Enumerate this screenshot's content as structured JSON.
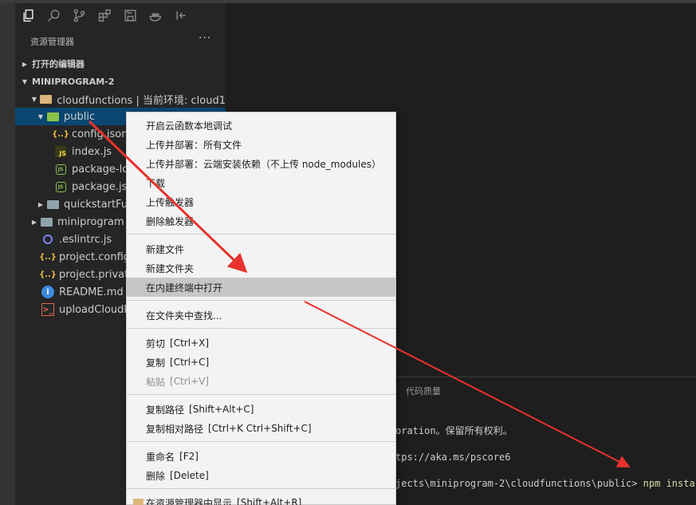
{
  "sidebar": {
    "title": "资源管理器",
    "more": "···",
    "sections": {
      "open_editors": "打开的编辑器",
      "project": "MINIPROGRAM-2"
    },
    "tree": [
      {
        "label": "cloudfunctions | 当前环境: cloud1",
        "icon": "folder-open-icon"
      },
      {
        "label": "public",
        "icon": "folder-green-icon"
      },
      {
        "label": "config.json",
        "icon": "json-icon",
        "glyph": "{..}"
      },
      {
        "label": "index.js",
        "icon": "js-icon",
        "glyph": "JS"
      },
      {
        "label": "package-lock.json",
        "icon": "node-icon",
        "glyph": "JS"
      },
      {
        "label": "package.json",
        "icon": "node-icon",
        "glyph": "JS"
      },
      {
        "label": "quickstartFunctions",
        "icon": "folder-icon"
      },
      {
        "label": "miniprogram",
        "icon": "folder-icon"
      },
      {
        "label": ".eslintrc.js",
        "icon": "eslint-icon"
      },
      {
        "label": "project.config.json",
        "icon": "json-icon",
        "glyph": "{..}"
      },
      {
        "label": "project.private.config.json",
        "icon": "json-icon",
        "glyph": "{..}"
      },
      {
        "label": "README.md",
        "icon": "info-icon",
        "glyph": "i"
      },
      {
        "label": "uploadCloudFunction.bat",
        "icon": "powershell-icon",
        "glyph": ">_"
      }
    ]
  },
  "menu": {
    "items": [
      {
        "label": "开启云函数本地调试"
      },
      {
        "label": "上传并部署：所有文件"
      },
      {
        "label": "上传并部署：云端安装依赖（不上传 node_modules）"
      },
      {
        "label": "下载"
      },
      {
        "label": "上传触发器"
      },
      {
        "label": "删除触发器"
      },
      {
        "label": "新建文件"
      },
      {
        "label": "新建文件夹"
      },
      {
        "label": "在内建终端中打开"
      },
      {
        "label": "在文件夹中查找..."
      },
      {
        "label": "剪切",
        "shortcut": "[Ctrl+X]"
      },
      {
        "label": "复制",
        "shortcut": "[Ctrl+C]"
      },
      {
        "label": "粘贴",
        "shortcut": "[Ctrl+V]"
      },
      {
        "label": "复制路径",
        "shortcut": "[Shift+Alt+C]"
      },
      {
        "label": "复制相对路径",
        "shortcut": "[Ctrl+K Ctrl+Shift+C]"
      },
      {
        "label": "重命名",
        "shortcut": "[F2]"
      },
      {
        "label": "删除",
        "shortcut": "[Delete]"
      },
      {
        "label": "在资源管理器中显示",
        "shortcut": "[Shift+Alt+R]"
      }
    ],
    "highlighted_item": "在内建终端中打开",
    "disabled_item": "粘贴"
  },
  "panel": {
    "tab_label": "代码质量",
    "terminal_lines": [
      "oration。保留所有权利。",
      "tps://aka.ms/pscore6",
      "jects\\miniprogram-2\\cloudfunctions\\public>"
    ],
    "command": "npm install"
  },
  "colors": {
    "selection": "#094771",
    "annotation_arrow": "#e8322d",
    "menu_highlight": "#c6c6c6"
  }
}
